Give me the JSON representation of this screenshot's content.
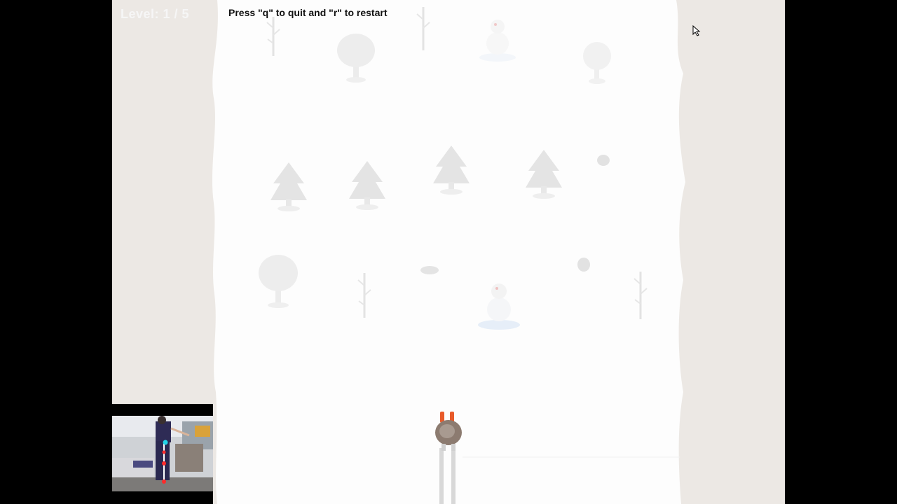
{
  "hud": {
    "level_text": "Level: 1 / 5",
    "instructions": "Press \"q\" to quit and \"r\" to restart"
  },
  "colors": {
    "letterbox": "#000000",
    "side_terrain": "#ece8e4",
    "snow": "#fdfdfd",
    "tree": "#e3e3e3",
    "flag_orange": "#e85a2a",
    "pose_joint_red": "#ff2a2a",
    "pose_joint_cyan": "#22d6e8"
  },
  "scene": {
    "obstacles": [
      {
        "type": "bare-tree"
      },
      {
        "type": "bare-tree"
      },
      {
        "type": "snowman"
      },
      {
        "type": "round-tree"
      },
      {
        "type": "round-tree"
      },
      {
        "type": "pine-tree"
      },
      {
        "type": "pine-tree"
      },
      {
        "type": "pine-tree"
      },
      {
        "type": "pine-tree"
      },
      {
        "type": "rock"
      },
      {
        "type": "rock"
      },
      {
        "type": "rock"
      },
      {
        "type": "round-tree"
      },
      {
        "type": "bare-tree"
      },
      {
        "type": "snowman"
      },
      {
        "type": "bare-tree"
      }
    ],
    "player": {
      "type": "skier"
    }
  },
  "webcam": {
    "feed": "pose-tracking-feed"
  }
}
